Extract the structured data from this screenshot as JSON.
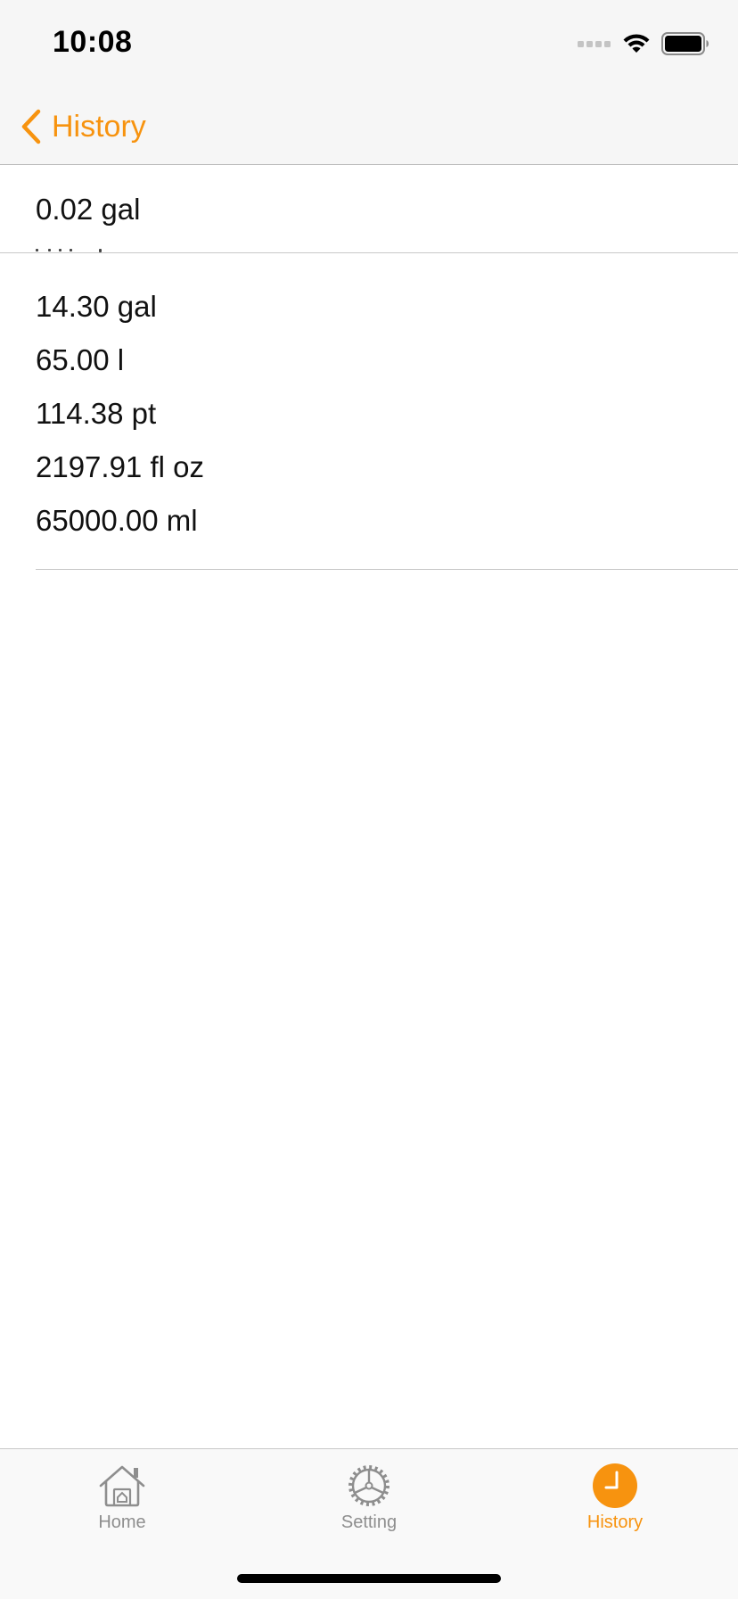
{
  "status_bar": {
    "time": "10:08"
  },
  "nav": {
    "back_label": "History",
    "accent_color": "#f7930f",
    "back_icon": "chevron-left-icon"
  },
  "history": {
    "first_value": "0.02 gal",
    "conversions": [
      "14.30 gal",
      "65.00 l",
      "114.38 pt",
      "2197.91 fl oz",
      "65000.00 ml"
    ]
  },
  "tab_bar": {
    "tabs": [
      {
        "label": "Home",
        "icon": "home-icon",
        "active": false
      },
      {
        "label": "Setting",
        "icon": "gear-icon",
        "active": false
      },
      {
        "label": "History",
        "icon": "clock-icon",
        "active": true
      }
    ],
    "inactive_color": "#8e8e8e",
    "active_color": "#f7930f"
  }
}
